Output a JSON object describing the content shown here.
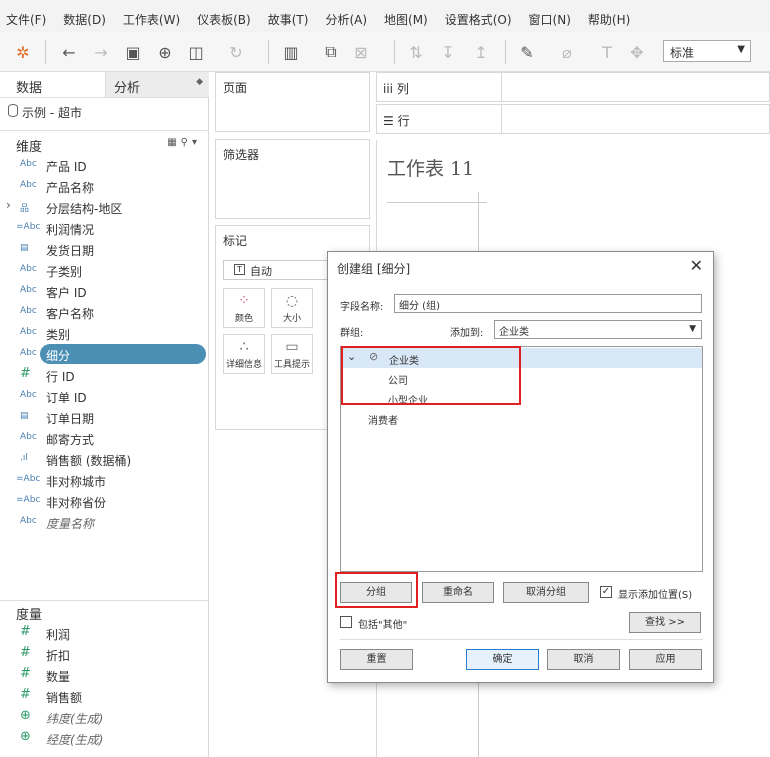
{
  "menu": [
    "文件(F)",
    "数据(D)",
    "工作表(W)",
    "仪表板(B)",
    "故事(T)",
    "分析(A)",
    "地图(M)",
    "设置格式(O)",
    "窗口(N)",
    "帮助(H)"
  ],
  "toolbar": {
    "fit_select": "标准"
  },
  "data_pane": {
    "tab_data": "数据",
    "tab_analysis": "分析",
    "datasource": "示例 - 超市",
    "dimensions_label": "维度",
    "dimensions": [
      {
        "type": "Abc",
        "name": "产品 ID"
      },
      {
        "type": "Abc",
        "name": "产品名称"
      },
      {
        "type": "hier",
        "name": "分层结构-地区"
      },
      {
        "type": "=Abc",
        "name": "利润情况"
      },
      {
        "type": "date",
        "name": "发货日期"
      },
      {
        "type": "Abc",
        "name": "子类别"
      },
      {
        "type": "Abc",
        "name": "客户 ID"
      },
      {
        "type": "Abc",
        "name": "客户名称"
      },
      {
        "type": "Abc",
        "name": "类别"
      },
      {
        "type": "Abc",
        "name": "细分",
        "selected": true
      },
      {
        "type": "#",
        "name": "行 ID"
      },
      {
        "type": "Abc",
        "name": "订单 ID"
      },
      {
        "type": "date",
        "name": "订单日期"
      },
      {
        "type": "Abc",
        "name": "邮寄方式"
      },
      {
        "type": "bin",
        "name": "销售额 (数据桶)"
      },
      {
        "type": "=Abc",
        "name": "非对称城市"
      },
      {
        "type": "=Abc",
        "name": "非对称省份"
      },
      {
        "type": "Abc",
        "name": "度量名称",
        "italic": true
      }
    ],
    "measures_label": "度量",
    "measures": [
      {
        "type": "#",
        "name": "利润"
      },
      {
        "type": "#",
        "name": "折扣"
      },
      {
        "type": "#",
        "name": "数量"
      },
      {
        "type": "#",
        "name": "销售额"
      },
      {
        "type": "globe",
        "name": "纬度(生成)",
        "italic": true
      },
      {
        "type": "globe",
        "name": "经度(生成)",
        "italic": true
      }
    ]
  },
  "shelves": {
    "pages": "页面",
    "filters": "筛选器",
    "marks": "标记",
    "marks_type": "自动",
    "color": "颜色",
    "size": "大小",
    "detail": "详细信息",
    "tooltip": "工具提示",
    "columns": "列",
    "rows": "行"
  },
  "sheet": {
    "title": "工作表 11"
  },
  "dialog": {
    "title": "创建组 [细分]",
    "field_name_label": "字段名称:",
    "field_name_value": "细分 (组)",
    "groups_label": "群组:",
    "add_to_label": "添加到:",
    "add_to_value": "企业类",
    "tree": {
      "group": "企业类",
      "members": [
        "公司",
        "小型企业"
      ],
      "ungrouped": [
        "消费者"
      ]
    },
    "btn_group": "分组",
    "btn_rename": "重命名",
    "btn_ungroup": "取消分组",
    "show_add_location": "显示添加位置(S)",
    "include_other": "包括\"其他\"",
    "btn_find": "查找 >>",
    "btn_reset": "重置",
    "btn_ok": "确定",
    "btn_cancel": "取消",
    "btn_apply": "应用"
  }
}
